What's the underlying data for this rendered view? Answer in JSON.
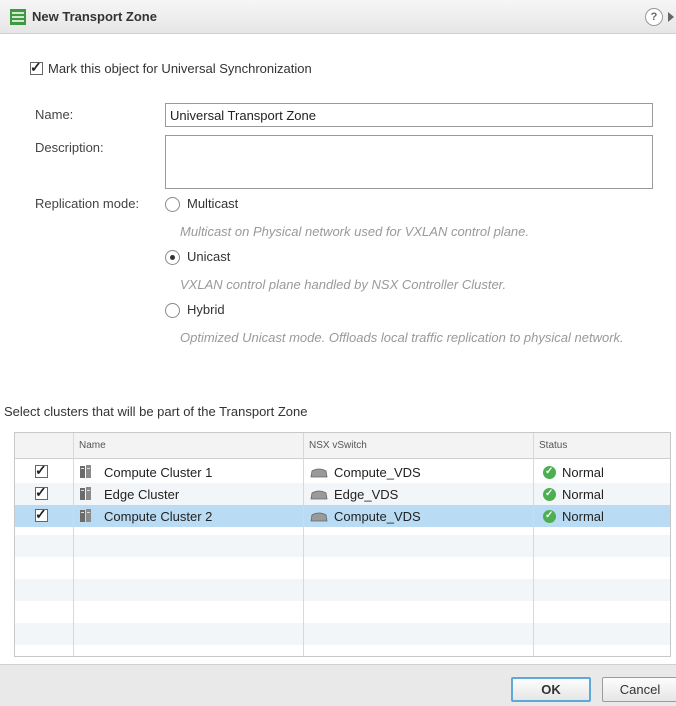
{
  "dialog": {
    "title": "New Transport Zone",
    "help_icon": "?"
  },
  "form": {
    "universal_sync": {
      "label": "Mark this object for Universal Synchronization",
      "checked": true
    },
    "name": {
      "label": "Name:",
      "value": "Universal Transport Zone"
    },
    "description": {
      "label": "Description:",
      "value": ""
    },
    "replication_mode": {
      "label": "Replication mode:",
      "selected": "Unicast",
      "options": [
        {
          "label": "Multicast",
          "description": "Multicast on Physical network used for VXLAN control plane."
        },
        {
          "label": "Unicast",
          "description": "VXLAN control plane handled by NSX Controller Cluster."
        },
        {
          "label": "Hybrid",
          "description": "Optimized Unicast mode. Offloads local traffic replication to physical network."
        }
      ]
    }
  },
  "clusters": {
    "label": "Select clusters that will be part of the Transport Zone",
    "columns": [
      "Name",
      "NSX vSwitch",
      "Status"
    ],
    "rows": [
      {
        "checked": true,
        "name": "Compute Cluster 1",
        "vswitch": "Compute_VDS",
        "status": "Normal",
        "selected": false
      },
      {
        "checked": true,
        "name": "Edge Cluster",
        "vswitch": "Edge_VDS",
        "status": "Normal",
        "selected": false
      },
      {
        "checked": true,
        "name": "Compute Cluster 2",
        "vswitch": "Compute_VDS",
        "status": "Normal",
        "selected": true
      }
    ],
    "icons": {
      "cluster": "cluster-icon",
      "vswitch": "vswitch-icon",
      "status": "check-circle-icon"
    },
    "colors": {
      "selected_row": "#b9dcf4",
      "status_ok": "#4caf50"
    }
  },
  "buttons": {
    "ok": "OK",
    "cancel": "Cancel"
  }
}
